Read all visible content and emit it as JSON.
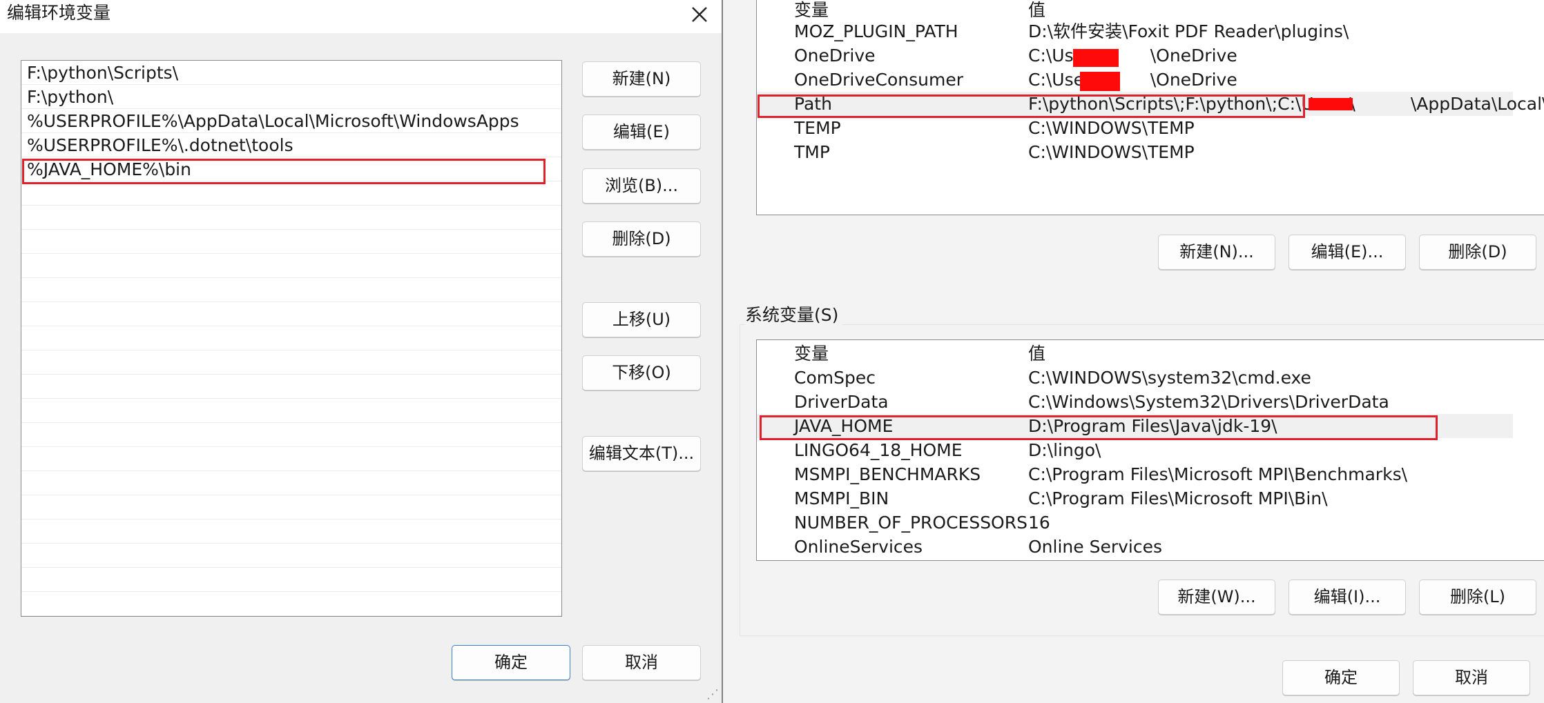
{
  "edit_dialog": {
    "title": "编辑环境变量",
    "path_entries": [
      "F:\\python\\Scripts\\",
      "F:\\python\\",
      "%USERPROFILE%\\AppData\\Local\\Microsoft\\WindowsApps",
      "%USERPROFILE%\\.dotnet\\tools",
      "%JAVA_HOME%\\bin"
    ],
    "buttons": {
      "new": "新建(N)",
      "edit": "编辑(E)",
      "browse": "浏览(B)...",
      "delete": "删除(D)",
      "move_up": "上移(U)",
      "move_down": "下移(O)",
      "edit_text": "编辑文本(T)...",
      "ok": "确定",
      "cancel": "取消"
    }
  },
  "env_window": {
    "user_vars": {
      "header": {
        "name": "变量",
        "value": "值"
      },
      "rows": [
        {
          "name": "MOZ_PLUGIN_PATH",
          "value": "D:\\软件安装\\Foxit PDF Reader\\plugins\\"
        },
        {
          "name": "OneDrive",
          "value": "C:\\Users\\",
          "value_suffix": "\\OneDrive"
        },
        {
          "name": "OneDriveConsumer",
          "value": "C:\\Users\\",
          "value_suffix": "\\OneDrive"
        },
        {
          "name": "Path",
          "value": "F:\\python\\Scripts\\;F:\\python\\;C:\\Users\\",
          "value_suffix": "\\AppData\\Local\\..."
        },
        {
          "name": "TEMP",
          "value": "C:\\WINDOWS\\TEMP"
        },
        {
          "name": "TMP",
          "value": "C:\\WINDOWS\\TEMP"
        }
      ],
      "buttons": {
        "new": "新建(N)...",
        "edit": "编辑(E)...",
        "delete": "删除(D)"
      }
    },
    "system_vars": {
      "group_label": "系统变量(S)",
      "header": {
        "name": "变量",
        "value": "值"
      },
      "rows": [
        {
          "name": "ComSpec",
          "value": "C:\\WINDOWS\\system32\\cmd.exe"
        },
        {
          "name": "DriverData",
          "value": "C:\\Windows\\System32\\Drivers\\DriverData"
        },
        {
          "name": "JAVA_HOME",
          "value": "D:\\Program Files\\Java\\jdk-19\\"
        },
        {
          "name": "LINGO64_18_HOME",
          "value": "D:\\lingo\\"
        },
        {
          "name": "MSMPI_BENCHMARKS",
          "value": "C:\\Program Files\\Microsoft MPI\\Benchmarks\\"
        },
        {
          "name": "MSMPI_BIN",
          "value": "C:\\Program Files\\Microsoft MPI\\Bin\\"
        },
        {
          "name": "NUMBER_OF_PROCESSORS",
          "value": "16"
        },
        {
          "name": "OnlineServices",
          "value": "Online Services"
        }
      ],
      "buttons": {
        "new": "新建(W)...",
        "edit": "编辑(I)...",
        "delete": "删除(L)"
      }
    },
    "footer_buttons": {
      "ok": "确定",
      "cancel": "取消"
    }
  },
  "colors": {
    "highlight": "#e0202a",
    "redaction": "#ff0a0a",
    "primary_border": "#3b7ccf"
  }
}
